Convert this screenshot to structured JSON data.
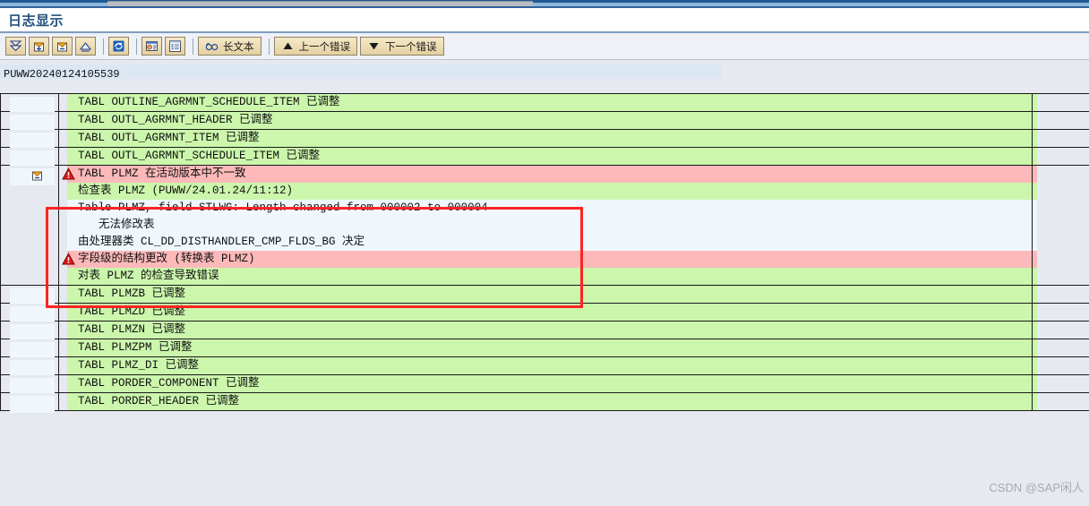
{
  "window": {
    "title": "日志显示"
  },
  "toolbar": {
    "buttons": [
      {
        "name": "expand-all-button",
        "icon": "double-chevron-down-icon",
        "label": ""
      },
      {
        "name": "expand-node-button",
        "icon": "expand-plus-icon",
        "label": ""
      },
      {
        "name": "collapse-node-button",
        "icon": "collapse-minus-icon",
        "label": ""
      },
      {
        "name": "collapse-all-button",
        "icon": "chevron-up-icon",
        "label": ""
      },
      {
        "name": "refresh-button",
        "icon": "refresh-icon",
        "label": ""
      },
      {
        "name": "details-button",
        "icon": "detail-window-icon",
        "label": ""
      },
      {
        "name": "list-button",
        "icon": "list-icon",
        "label": ""
      },
      {
        "name": "long-text-button",
        "icon": "glasses-icon",
        "label": "长文本"
      },
      {
        "name": "previous-error-button",
        "icon": "triangle-up-icon",
        "label": "上一个错误"
      },
      {
        "name": "next-error-button",
        "icon": "triangle-down-icon",
        "label": "下一个错误"
      }
    ]
  },
  "log": {
    "id": "PUWW20240124105539",
    "groups": [
      {
        "gutter_icon": "",
        "rows": [
          {
            "text": "TABL OUTLINE_AGRMNT_SCHEDULE_ITEM 已调整",
            "bg": "green",
            "warn": false,
            "indent": 0
          }
        ]
      },
      {
        "gutter_icon": "",
        "rows": [
          {
            "text": "TABL OUTL_AGRMNT_HEADER 已调整",
            "bg": "green",
            "warn": false,
            "indent": 0
          }
        ]
      },
      {
        "gutter_icon": "",
        "rows": [
          {
            "text": "TABL OUTL_AGRMNT_ITEM 已调整",
            "bg": "green",
            "warn": false,
            "indent": 0
          }
        ]
      },
      {
        "gutter_icon": "",
        "rows": [
          {
            "text": "TABL OUTL_AGRMNT_SCHEDULE_ITEM 已调整",
            "bg": "green",
            "warn": false,
            "indent": 0
          }
        ]
      },
      {
        "gutter_icon": "collapse-minus-icon",
        "rows": [
          {
            "text": "TABL PLMZ 在活动版本中不一致",
            "bg": "red",
            "warn": true,
            "indent": 0
          },
          {
            "text": "检查表 PLMZ (PUWW/24.01.24/11:12)",
            "bg": "green",
            "warn": false,
            "indent": 0
          },
          {
            "text": "Table PLMZ, field STLWG: Length changed from 000002 to 000004",
            "bg": "white",
            "warn": false,
            "indent": 0
          },
          {
            "text": "无法修改表",
            "bg": "white",
            "warn": false,
            "indent": 2
          },
          {
            "text": "由处理器类 CL_DD_DISTHANDLER_CMP_FLDS_BG 决定",
            "bg": "white",
            "warn": false,
            "indent": 0
          },
          {
            "text": "字段级的结构更改 (转换表 PLMZ)",
            "bg": "red",
            "warn": true,
            "indent": 0
          },
          {
            "text": "对表 PLMZ 的检查导致错误",
            "bg": "green",
            "warn": false,
            "indent": 0
          }
        ]
      },
      {
        "gutter_icon": "",
        "rows": [
          {
            "text": "TABL PLMZB 已调整",
            "bg": "green",
            "warn": false,
            "indent": 0
          }
        ]
      },
      {
        "gutter_icon": "",
        "rows": [
          {
            "text": "TABL PLMZD 已调整",
            "bg": "green",
            "warn": false,
            "indent": 0
          }
        ]
      },
      {
        "gutter_icon": "",
        "rows": [
          {
            "text": "TABL PLMZN 已调整",
            "bg": "green",
            "warn": false,
            "indent": 0
          }
        ]
      },
      {
        "gutter_icon": "",
        "rows": [
          {
            "text": "TABL PLMZPM 已调整",
            "bg": "green",
            "warn": false,
            "indent": 0
          }
        ]
      },
      {
        "gutter_icon": "",
        "rows": [
          {
            "text": "TABL PLMZ_DI 已调整",
            "bg": "green",
            "warn": false,
            "indent": 0
          }
        ]
      },
      {
        "gutter_icon": "",
        "rows": [
          {
            "text": "TABL PORDER_COMPONENT 已调整",
            "bg": "green",
            "warn": false,
            "indent": 0
          }
        ]
      },
      {
        "gutter_icon": "",
        "rows": [
          {
            "text": "TABL PORDER_HEADER 已调整",
            "bg": "green",
            "warn": false,
            "indent": 0
          }
        ]
      }
    ]
  },
  "watermark": {
    "text": "CSDN @SAP闲人"
  },
  "colors": {
    "row_green": "#cbf6ac",
    "row_red": "#fdb9b9",
    "row_white": "#eff7fd",
    "highlight_border": "#fb2424",
    "title_text": "#24527f",
    "toolbar_button": "#e4d1a2"
  }
}
